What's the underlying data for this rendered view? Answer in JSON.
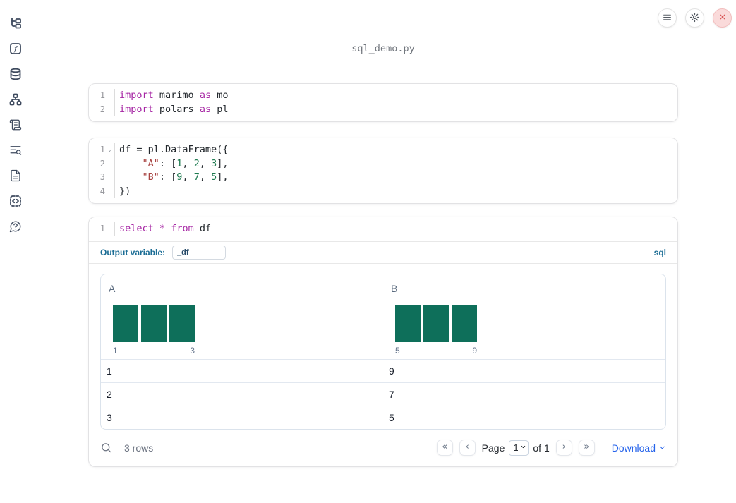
{
  "title": "sql_demo.py",
  "colors": {
    "keyword": "#a626a4",
    "string": "#a94442",
    "number": "#1d7a4f",
    "histogram_bar": "#0e6f5a",
    "label_blue": "#1b6d95",
    "link_blue": "#2563eb",
    "close_red": "#d64f4f"
  },
  "topbar": {
    "buttons": [
      {
        "icon": "hamburger-menu-icon",
        "label": "menu"
      },
      {
        "icon": "gear-icon",
        "label": "settings"
      },
      {
        "icon": "close-icon",
        "label": "close"
      }
    ]
  },
  "sidebar": {
    "items": [
      {
        "icon": "file-tree-icon"
      },
      {
        "icon": "function-icon"
      },
      {
        "icon": "database-icon"
      },
      {
        "icon": "dependency-graph-icon"
      },
      {
        "icon": "scroll-logs-icon"
      },
      {
        "icon": "list-search-icon"
      },
      {
        "icon": "document-icon"
      },
      {
        "icon": "snippets-icon"
      },
      {
        "icon": "help-icon"
      }
    ]
  },
  "cells": [
    {
      "type": "python",
      "lines": [
        {
          "num": "1",
          "tokens": [
            {
              "t": "import",
              "c": "kw"
            },
            {
              "t": " marimo ",
              "c": "pl"
            },
            {
              "t": "as",
              "c": "kw"
            },
            {
              "t": " mo",
              "c": "pl"
            }
          ]
        },
        {
          "num": "2",
          "tokens": [
            {
              "t": "import",
              "c": "kw"
            },
            {
              "t": " polars ",
              "c": "pl"
            },
            {
              "t": "as",
              "c": "kw"
            },
            {
              "t": " pl",
              "c": "pl"
            }
          ]
        }
      ]
    },
    {
      "type": "python",
      "lines": [
        {
          "num": "1",
          "fold": true,
          "tokens": [
            {
              "t": "df = pl.DataFrame({",
              "c": "pl"
            }
          ]
        },
        {
          "num": "2",
          "tokens": [
            {
              "t": "    ",
              "c": "pl"
            },
            {
              "t": "\"A\"",
              "c": "str"
            },
            {
              "t": ": [",
              "c": "pl"
            },
            {
              "t": "1",
              "c": "num"
            },
            {
              "t": ", ",
              "c": "pl"
            },
            {
              "t": "2",
              "c": "num"
            },
            {
              "t": ", ",
              "c": "pl"
            },
            {
              "t": "3",
              "c": "num"
            },
            {
              "t": "],",
              "c": "pl"
            }
          ]
        },
        {
          "num": "3",
          "tokens": [
            {
              "t": "    ",
              "c": "pl"
            },
            {
              "t": "\"B\"",
              "c": "str"
            },
            {
              "t": ": [",
              "c": "pl"
            },
            {
              "t": "9",
              "c": "num"
            },
            {
              "t": ", ",
              "c": "pl"
            },
            {
              "t": "7",
              "c": "num"
            },
            {
              "t": ", ",
              "c": "pl"
            },
            {
              "t": "5",
              "c": "num"
            },
            {
              "t": "],",
              "c": "pl"
            }
          ]
        },
        {
          "num": "4",
          "tokens": [
            {
              "t": "})",
              "c": "pl"
            }
          ]
        }
      ]
    },
    {
      "type": "sql",
      "lines": [
        {
          "num": "1",
          "tokens": [
            {
              "t": "select",
              "c": "kw"
            },
            {
              "t": " ",
              "c": "pl"
            },
            {
              "t": "*",
              "c": "kw"
            },
            {
              "t": " ",
              "c": "pl"
            },
            {
              "t": "from",
              "c": "kw"
            },
            {
              "t": " df",
              "c": "pl"
            }
          ]
        }
      ],
      "toolbar": {
        "output_variable_label": "Output variable:",
        "output_variable_value": "_df",
        "language_label": "sql"
      }
    }
  ],
  "table": {
    "columns": [
      {
        "header": "A",
        "hist": {
          "bars": [
            1,
            1,
            1
          ],
          "min_label": "1",
          "max_label": "3"
        }
      },
      {
        "header": "B",
        "hist": {
          "bars": [
            1,
            1,
            1
          ],
          "min_label": "5",
          "max_label": "9"
        }
      }
    ],
    "rows": [
      [
        "1",
        "9"
      ],
      [
        "2",
        "7"
      ],
      [
        "3",
        "5"
      ]
    ],
    "footer": {
      "row_count": "3 rows",
      "page_label": "Page",
      "page_value": "1",
      "of_label": "of 1",
      "first_page_glyph": "«",
      "prev_page_glyph": "‹",
      "next_page_glyph": "›",
      "last_page_glyph": "»",
      "download_label": "Download"
    }
  }
}
